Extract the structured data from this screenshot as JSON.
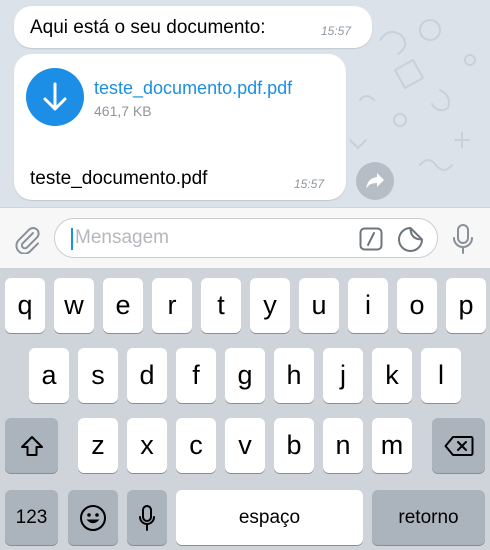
{
  "chat": {
    "message1": {
      "text": "Aqui está o seu documento:",
      "time": "15:57"
    },
    "message2": {
      "file_name": "teste_documento.pdf.pdf",
      "file_size": "461,7 KB",
      "caption": "teste_documento.pdf",
      "time": "15:57"
    }
  },
  "input": {
    "placeholder": "Mensagem",
    "value": ""
  },
  "keyboard": {
    "row1": [
      "q",
      "w",
      "e",
      "r",
      "t",
      "y",
      "u",
      "i",
      "o",
      "p"
    ],
    "row2": [
      "a",
      "s",
      "d",
      "f",
      "g",
      "h",
      "j",
      "k",
      "l"
    ],
    "row3": [
      "z",
      "x",
      "c",
      "v",
      "b",
      "n",
      "m"
    ],
    "numbers_label": "123",
    "space_label": "espaço",
    "return_label": "retorno"
  },
  "icons": {
    "download": "download-arrow-icon",
    "share": "share-arrow-icon",
    "attach": "paperclip-icon",
    "command": "slash-command-icon",
    "sticker": "sticker-icon",
    "mic": "microphone-icon",
    "shift": "shift-icon",
    "backspace": "backspace-icon",
    "emoji": "emoji-icon",
    "dictation": "dictation-mic-icon"
  },
  "colors": {
    "accent": "#1c8ee6",
    "link": "#1e8fdd",
    "bubble": "#ffffff"
  }
}
